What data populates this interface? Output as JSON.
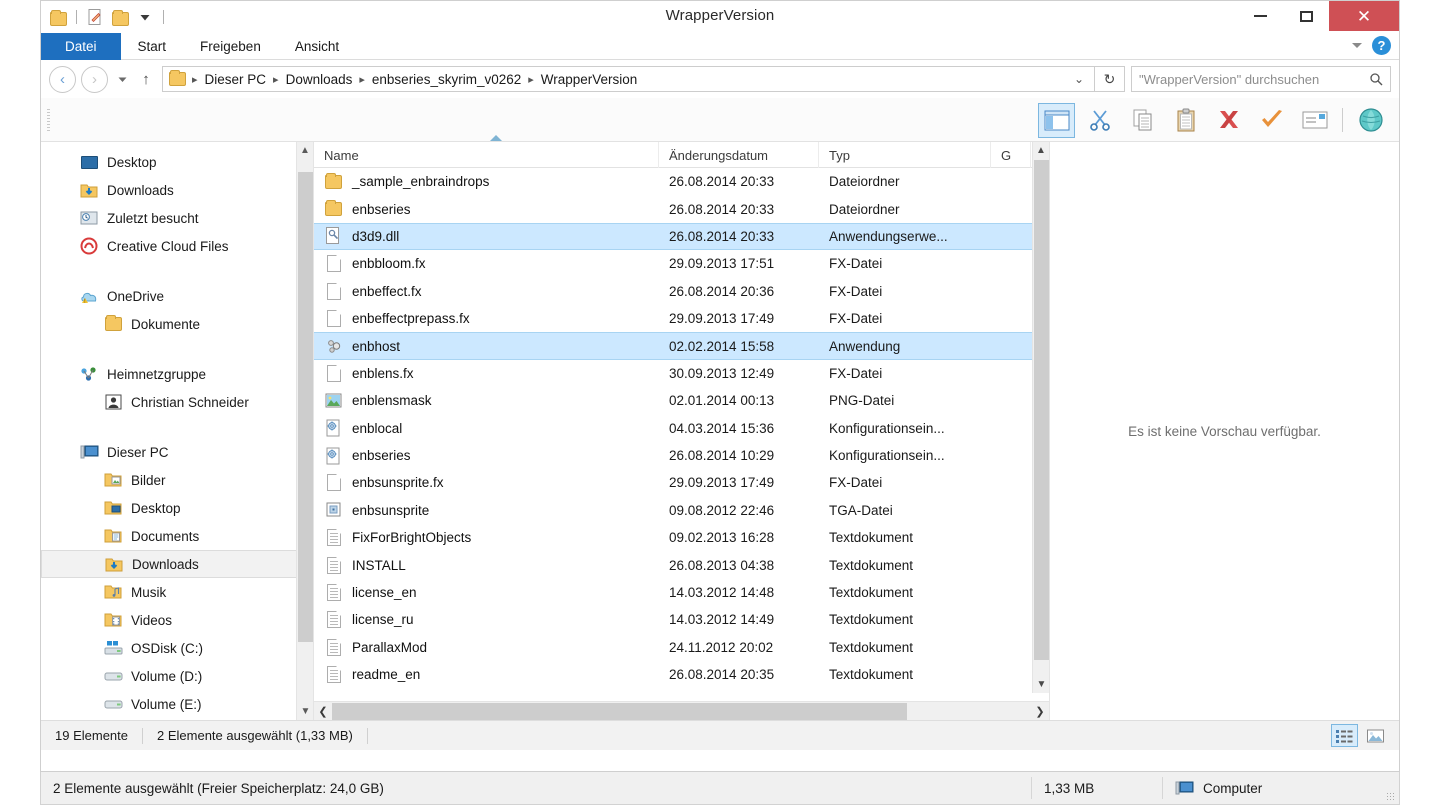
{
  "window": {
    "title": "WrapperVersion",
    "quick_access": [
      {
        "name": "folder-icon",
        "label": "Ordner"
      },
      {
        "name": "new-item-icon",
        "label": "Neues Element"
      },
      {
        "name": "new-folder-icon",
        "label": "Neuer Ordner"
      },
      {
        "name": "chevron-down-icon",
        "label": "Schnellzugriff anpassen"
      }
    ],
    "controls": {
      "minimize": "Minimieren",
      "maximize": "Maximieren",
      "close": "Schließen",
      "close_glyph": "✕"
    }
  },
  "ribbon": {
    "tabs": [
      {
        "label": "Datei",
        "active": true
      },
      {
        "label": "Start",
        "active": false
      },
      {
        "label": "Freigeben",
        "active": false
      },
      {
        "label": "Ansicht",
        "active": false
      }
    ],
    "expand_label": "Menüband erweitern",
    "help_label": "?"
  },
  "address": {
    "back_glyph": "‹",
    "forward_glyph": "›",
    "recent_label": "Zuletzt verwendete Orte",
    "up_glyph": "↑",
    "breadcrumbs": [
      "Dieser PC",
      "Downloads",
      "enbseries_skyrim_v0262",
      "WrapperVersion"
    ],
    "separator": "▸",
    "dropdown_glyph": "⌄",
    "refresh_glyph": "↻"
  },
  "search": {
    "placeholder": "\"WrapperVersion\" durchsuchen",
    "icon": "search-icon"
  },
  "toolbar": {
    "buttons": [
      {
        "name": "layout-pane-button",
        "label": "Vorschaufenster",
        "active": true
      },
      {
        "name": "cut-button",
        "label": "Ausschneiden",
        "active": false
      },
      {
        "name": "copy-button",
        "label": "Kopieren",
        "active": false
      },
      {
        "name": "paste-button",
        "label": "Einfügen",
        "active": false
      },
      {
        "name": "delete-button",
        "label": "Löschen",
        "active": false
      },
      {
        "name": "confirm-button",
        "label": "Bestätigen",
        "active": false
      },
      {
        "name": "rename-button",
        "label": "Umbenennen",
        "active": false
      },
      {
        "name": "shell-button",
        "label": "Shell",
        "active": false
      }
    ]
  },
  "sidebar": {
    "groups": [
      {
        "items": [
          {
            "label": "Desktop",
            "icon": "desktop-icon",
            "indent": 0,
            "selected": false
          },
          {
            "label": "Downloads",
            "icon": "downloads-folder-icon",
            "indent": 0,
            "selected": false
          },
          {
            "label": "Zuletzt besucht",
            "icon": "recent-places-icon",
            "indent": 0,
            "selected": false
          },
          {
            "label": "Creative Cloud Files",
            "icon": "creative-cloud-icon",
            "indent": 0,
            "selected": false
          }
        ]
      },
      {
        "items": [
          {
            "label": "OneDrive",
            "icon": "onedrive-icon",
            "indent": 0,
            "selected": false
          },
          {
            "label": "Dokumente",
            "icon": "folder-icon",
            "indent": 1,
            "selected": false
          }
        ]
      },
      {
        "items": [
          {
            "label": "Heimnetzgruppe",
            "icon": "homegroup-icon",
            "indent": 0,
            "selected": false
          },
          {
            "label": "Christian Schneider",
            "icon": "user-icon",
            "indent": 1,
            "selected": false
          }
        ]
      },
      {
        "items": [
          {
            "label": "Dieser PC",
            "icon": "this-pc-icon",
            "indent": 0,
            "selected": false
          },
          {
            "label": "Bilder",
            "icon": "pictures-folder-icon",
            "indent": 1,
            "selected": false
          },
          {
            "label": "Desktop",
            "icon": "desktop-folder-icon",
            "indent": 1,
            "selected": false
          },
          {
            "label": "Documents",
            "icon": "documents-folder-icon",
            "indent": 1,
            "selected": false
          },
          {
            "label": "Downloads",
            "icon": "downloads-folder-icon",
            "indent": 1,
            "selected": true
          },
          {
            "label": "Musik",
            "icon": "music-folder-icon",
            "indent": 1,
            "selected": false
          },
          {
            "label": "Videos",
            "icon": "videos-folder-icon",
            "indent": 1,
            "selected": false
          },
          {
            "label": "OSDisk (C:)",
            "icon": "windows-drive-icon",
            "indent": 1,
            "selected": false
          },
          {
            "label": "Volume (D:)",
            "icon": "drive-icon",
            "indent": 1,
            "selected": false
          },
          {
            "label": "Volume (E:)",
            "icon": "drive-icon",
            "indent": 1,
            "selected": false
          }
        ]
      }
    ]
  },
  "filelist": {
    "columns": [
      {
        "label": "Name",
        "sorted": true,
        "sort_dir": "asc"
      },
      {
        "label": "Änderungsdatum",
        "sorted": false
      },
      {
        "label": "Typ",
        "sorted": false
      },
      {
        "label": "G",
        "sorted": false
      }
    ],
    "rows": [
      {
        "name": "_sample_enbraindrops",
        "date": "26.08.2014 20:33",
        "type": "Dateiordner",
        "icon": "folder-icon",
        "selected": false
      },
      {
        "name": "enbseries",
        "date": "26.08.2014 20:33",
        "type": "Dateiordner",
        "icon": "folder-icon",
        "selected": false
      },
      {
        "name": "d3d9.dll",
        "date": "26.08.2014 20:33",
        "type": "Anwendungserwe...",
        "icon": "dll-icon",
        "selected": true
      },
      {
        "name": "enbbloom.fx",
        "date": "29.09.2013 17:51",
        "type": "FX-Datei",
        "icon": "blank-file-icon",
        "selected": false
      },
      {
        "name": "enbeffect.fx",
        "date": "26.08.2014 20:36",
        "type": "FX-Datei",
        "icon": "blank-file-icon",
        "selected": false
      },
      {
        "name": "enbeffectprepass.fx",
        "date": "29.09.2013 17:49",
        "type": "FX-Datei",
        "icon": "blank-file-icon",
        "selected": false
      },
      {
        "name": "enbhost",
        "date": "02.02.2014 15:58",
        "type": "Anwendung",
        "icon": "application-icon",
        "selected": true
      },
      {
        "name": "enblens.fx",
        "date": "30.09.2013 12:49",
        "type": "FX-Datei",
        "icon": "blank-file-icon",
        "selected": false
      },
      {
        "name": "enblensmask",
        "date": "02.01.2014 00:13",
        "type": "PNG-Datei",
        "icon": "image-icon",
        "selected": false
      },
      {
        "name": "enblocal",
        "date": "04.03.2014 15:36",
        "type": "Konfigurationsein...",
        "icon": "settings-file-icon",
        "selected": false
      },
      {
        "name": "enbseries",
        "date": "26.08.2014 10:29",
        "type": "Konfigurationsein...",
        "icon": "settings-file-icon",
        "selected": false
      },
      {
        "name": "enbsunsprite.fx",
        "date": "29.09.2013 17:49",
        "type": "FX-Datei",
        "icon": "blank-file-icon",
        "selected": false
      },
      {
        "name": "enbsunsprite",
        "date": "09.08.2012 22:46",
        "type": "TGA-Datei",
        "icon": "tga-file-icon",
        "selected": false
      },
      {
        "name": "FixForBrightObjects",
        "date": "09.02.2013 16:28",
        "type": "Textdokument",
        "icon": "text-file-icon",
        "selected": false
      },
      {
        "name": "INSTALL",
        "date": "26.08.2013 04:38",
        "type": "Textdokument",
        "icon": "text-file-icon",
        "selected": false
      },
      {
        "name": "license_en",
        "date": "14.03.2012 14:48",
        "type": "Textdokument",
        "icon": "text-file-icon",
        "selected": false
      },
      {
        "name": "license_ru",
        "date": "14.03.2012 14:49",
        "type": "Textdokument",
        "icon": "text-file-icon",
        "selected": false
      },
      {
        "name": "ParallaxMod",
        "date": "24.11.2012 20:02",
        "type": "Textdokument",
        "icon": "text-file-icon",
        "selected": false
      },
      {
        "name": "readme_en",
        "date": "26.08.2014 20:35",
        "type": "Textdokument",
        "icon": "text-file-icon",
        "selected": false
      }
    ]
  },
  "preview": {
    "message": "Es ist keine Vorschau verfügbar."
  },
  "statusbar": {
    "item_count": "19 Elemente",
    "selection": "2 Elemente ausgewählt (1,33 MB)",
    "view_buttons": [
      {
        "name": "details-view-button",
        "label": "Details",
        "active": true
      },
      {
        "name": "large-icons-view-button",
        "label": "Große Symbole",
        "active": false
      }
    ]
  },
  "bottombar": {
    "selection": "2 Elemente ausgewählt (Freier Speicherplatz: 24,0 GB)",
    "size": "1,33 MB",
    "location": "Computer",
    "location_icon": "computer-icon"
  },
  "colors": {
    "accent": "#1e6fbf",
    "selection": "#cce8ff",
    "close_button": "#cf5055",
    "folder": "#f5c761"
  }
}
